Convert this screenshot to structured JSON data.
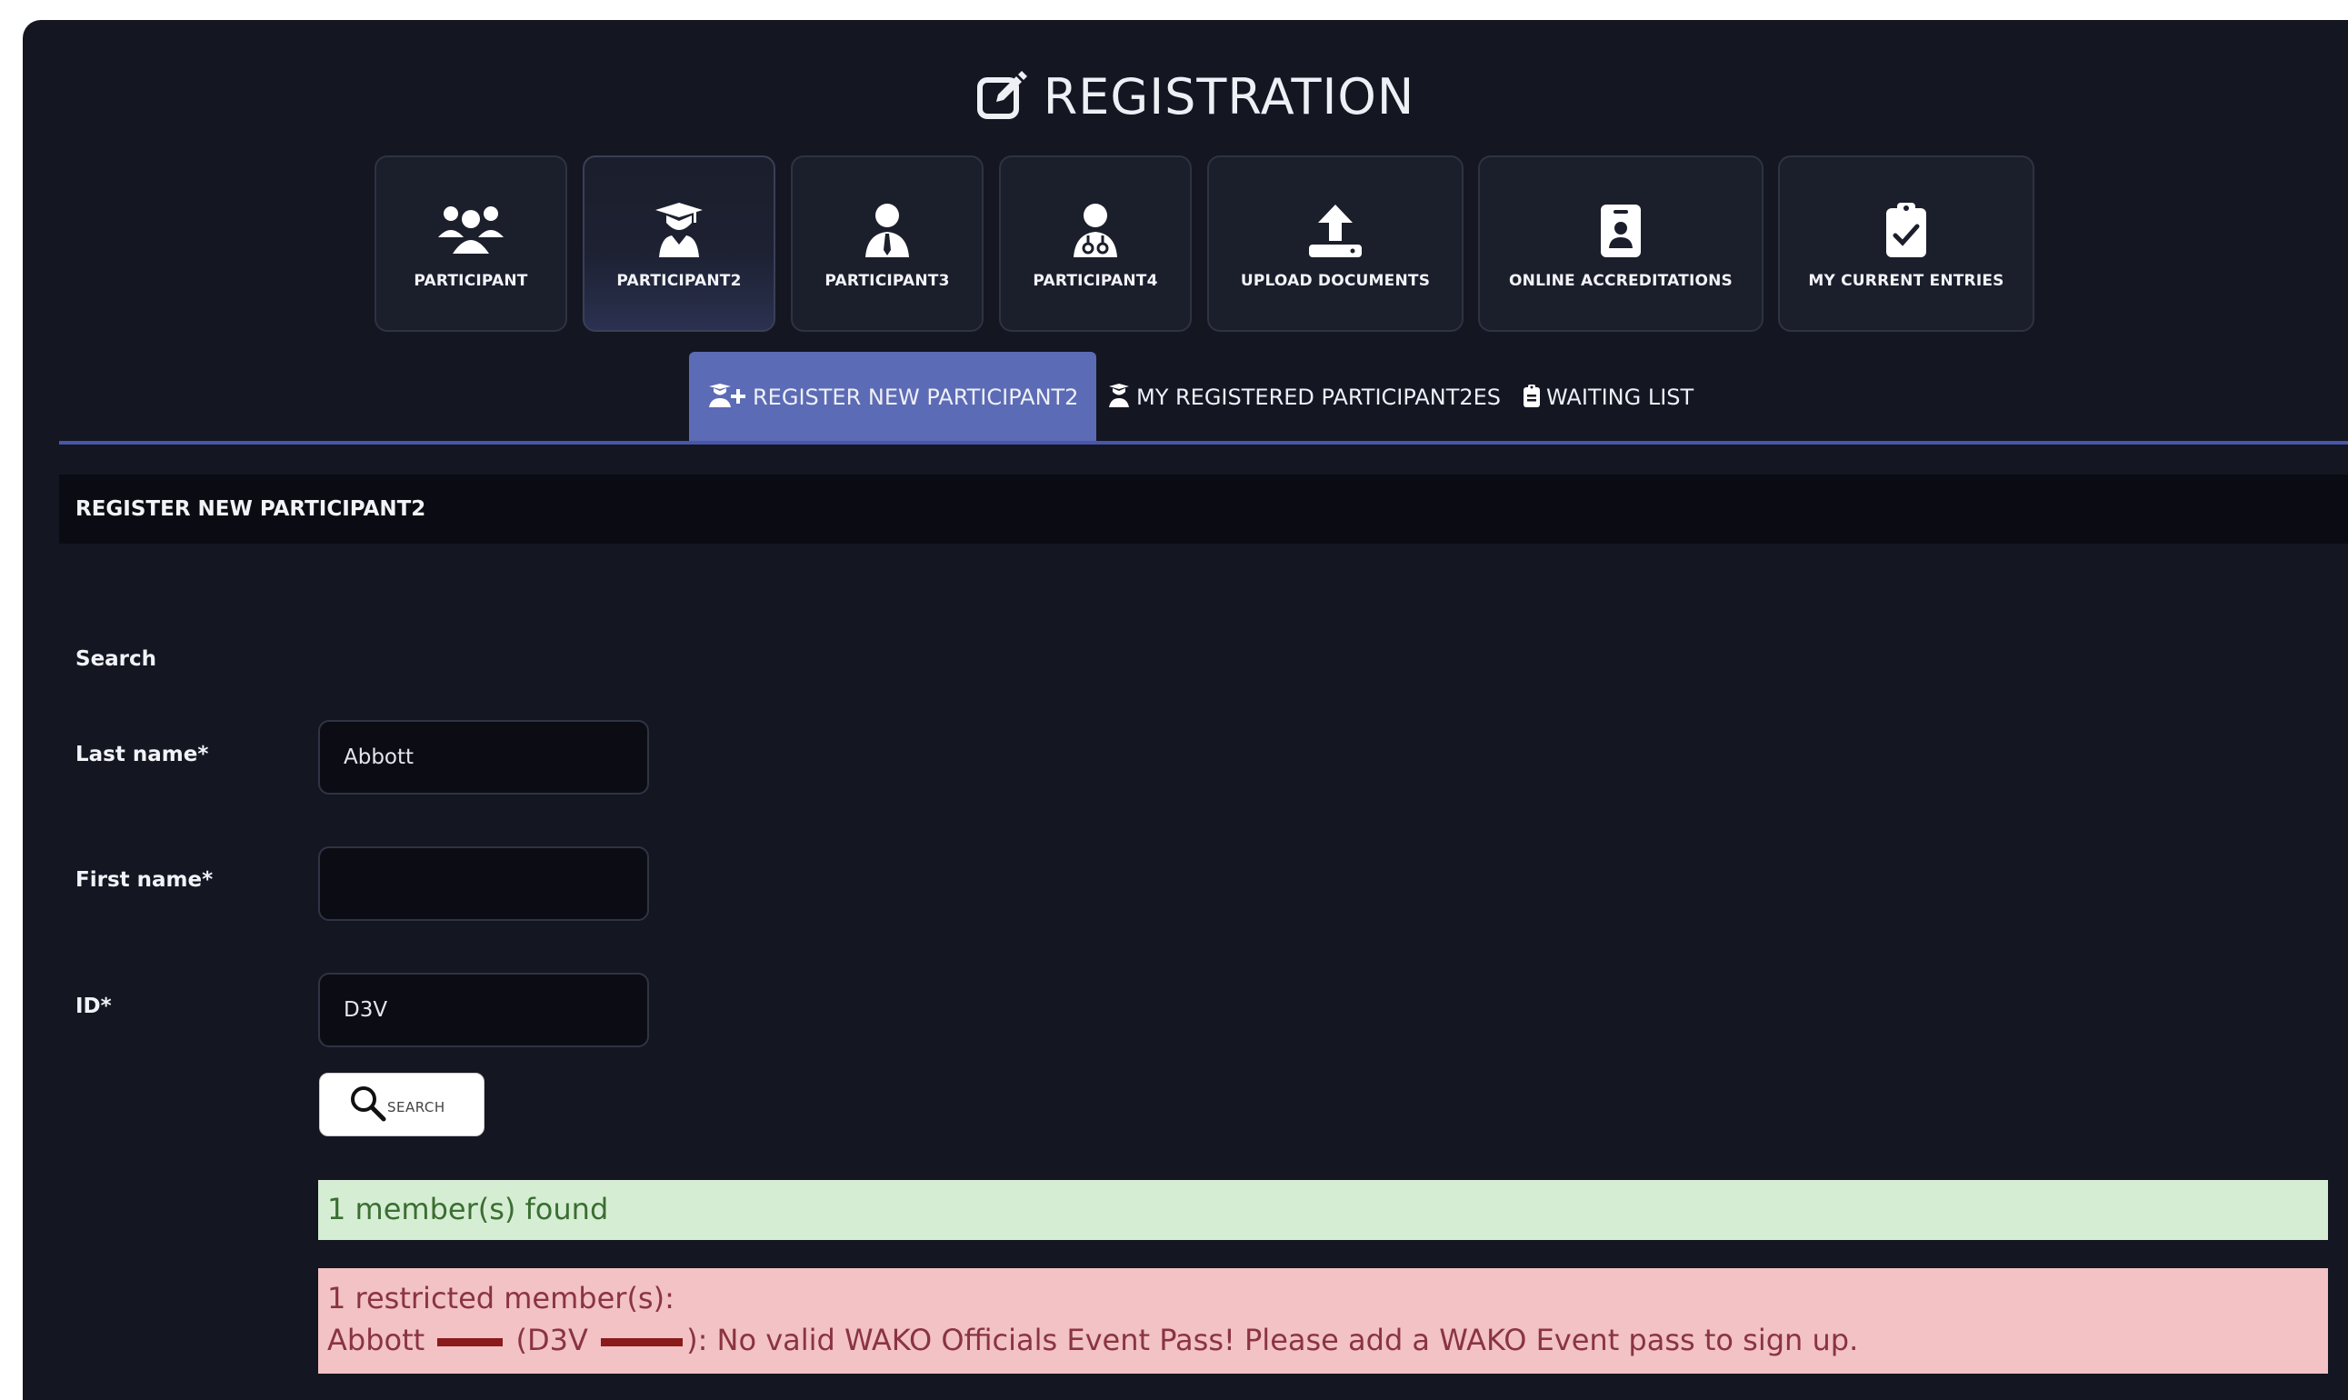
{
  "header": {
    "title": "REGISTRATION",
    "icon": "edit-icon"
  },
  "categories": [
    {
      "label": "PARTICIPANT",
      "icon": "users-group-icon",
      "active": false
    },
    {
      "label": "PARTICIPANT2",
      "icon": "graduate-icon",
      "active": true
    },
    {
      "label": "PARTICIPANT3",
      "icon": "user-tie-icon",
      "active": false
    },
    {
      "label": "PARTICIPANT4",
      "icon": "doctor-icon",
      "active": false
    },
    {
      "label": "UPLOAD DOCUMENTS",
      "icon": "upload-icon",
      "active": false
    },
    {
      "label": "ONLINE ACCREDITATIONS",
      "icon": "id-badge-icon",
      "active": false
    },
    {
      "label": "MY CURRENT ENTRIES",
      "icon": "clipboard-check-icon",
      "active": false
    }
  ],
  "tabs": [
    {
      "label": "REGISTER NEW PARTICIPANT2",
      "icon": "user-add-icon",
      "active": true
    },
    {
      "label": "MY REGISTERED PARTICIPANT2ES",
      "icon": "graduate-icon",
      "active": false
    },
    {
      "label": "WAITING LIST",
      "icon": "clipboard-icon",
      "active": false
    }
  ],
  "section": {
    "title": "REGISTER NEW PARTICIPANT2"
  },
  "form": {
    "search_heading": "Search",
    "last_name_label": "Last name*",
    "last_name_value": "Abbott",
    "first_name_label": "First name*",
    "first_name_value": "",
    "id_label": "ID*",
    "id_value": "D3V",
    "search_button": "SEARCH"
  },
  "results": {
    "found": "1 member(s) found",
    "restricted_title": "1 restricted member(s):",
    "restricted_name": "Abbott",
    "restricted_id_prefix": "(D3V",
    "restricted_message": "): No valid WAKO Officials Event Pass! Please add a WAKO Event pass to sign up."
  },
  "colors": {
    "background": "#141622",
    "accent": "#5c6bb5",
    "success_bg": "#d5eed3",
    "danger_bg": "#f2c2c4",
    "redaction": "#8b1a1a"
  }
}
